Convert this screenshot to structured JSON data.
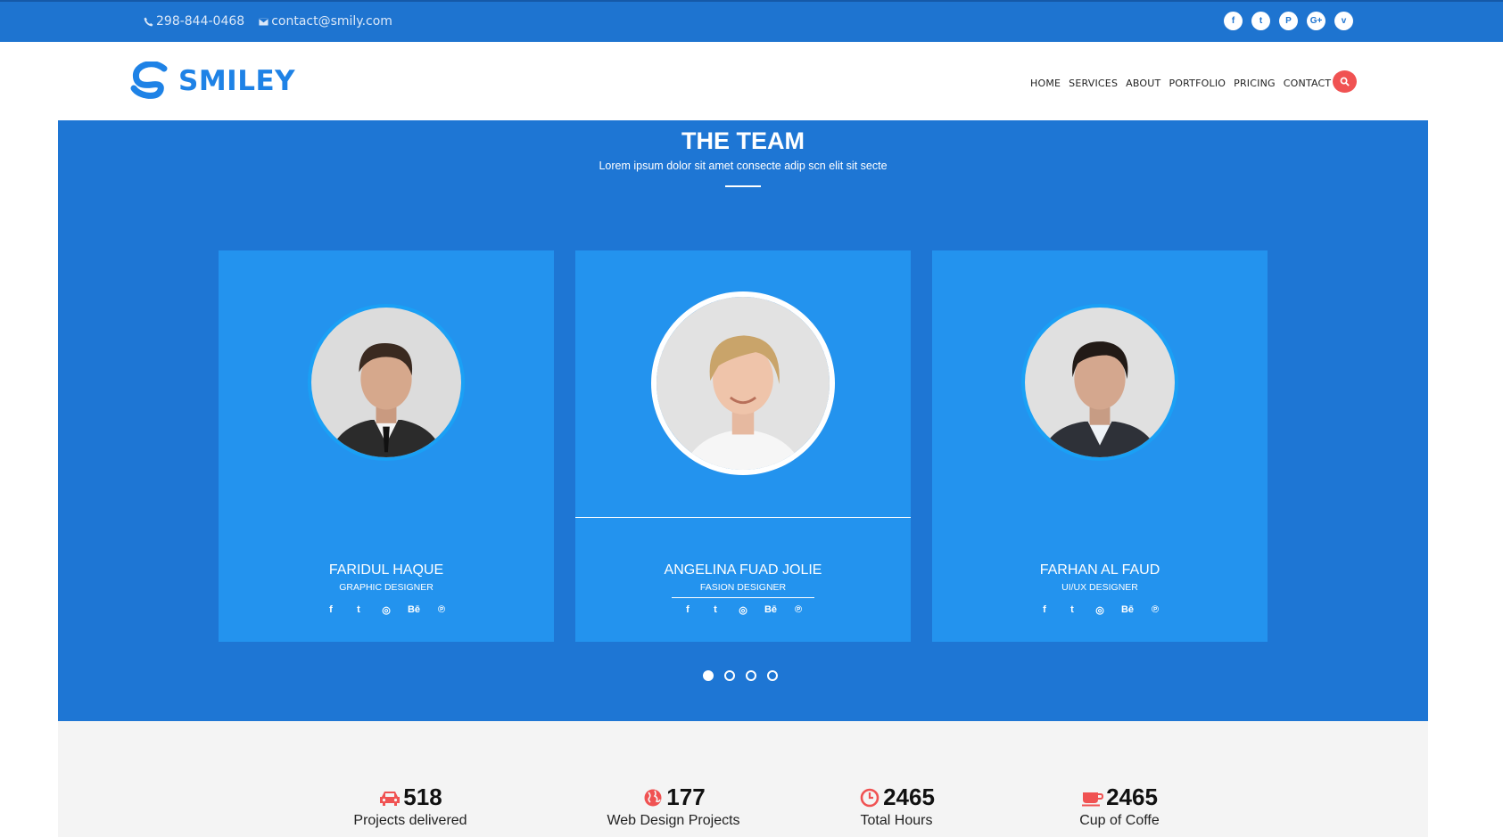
{
  "topbar": {
    "phone": "298-844-0468",
    "email": "contact@smily.com",
    "socials": [
      {
        "icon": "facebook-icon",
        "glyph": "f"
      },
      {
        "icon": "twitter-icon",
        "glyph": "t"
      },
      {
        "icon": "pinterest-icon",
        "glyph": "P"
      },
      {
        "icon": "google-plus-icon",
        "glyph": "G+"
      },
      {
        "icon": "vimeo-icon",
        "glyph": "v"
      }
    ]
  },
  "header": {
    "logo_text": "SMILEY",
    "nav": [
      "HOME",
      "SERVICES",
      "ABOUT",
      "PORTFOLIO",
      "PRICING",
      "CONTACT US"
    ]
  },
  "team": {
    "title": "THE TEAM",
    "subtitle": "Lorem ipsum dolor sit amet consecte adip scn elit sit secte",
    "members": [
      {
        "name": "FARIDUL HAQUE",
        "role": "GRAPHIC DESIGNER"
      },
      {
        "name": "ANGELINA FUAD JOLIE",
        "role": "FASION DESIGNER"
      },
      {
        "name": "FARHAN AL FAUD",
        "role": "UI/UX DESIGNER"
      }
    ],
    "member_social_glyphs": [
      "f",
      "t",
      "◎",
      "Bē",
      "℗"
    ],
    "carousel": {
      "pages": 4,
      "active": 1
    }
  },
  "stats": [
    {
      "icon": "car-icon",
      "value": "518",
      "label": "Projects delivered"
    },
    {
      "icon": "globe-icon",
      "value": "177",
      "label": "Web Design Projects"
    },
    {
      "icon": "clock-icon",
      "value": "2465",
      "label": "Total Hours"
    },
    {
      "icon": "coffee-icon",
      "value": "2465",
      "label": "Cup of Coffe"
    }
  ],
  "colors": {
    "primary": "#1e76d4",
    "card": "#2393ee",
    "accent": "#f05252"
  }
}
